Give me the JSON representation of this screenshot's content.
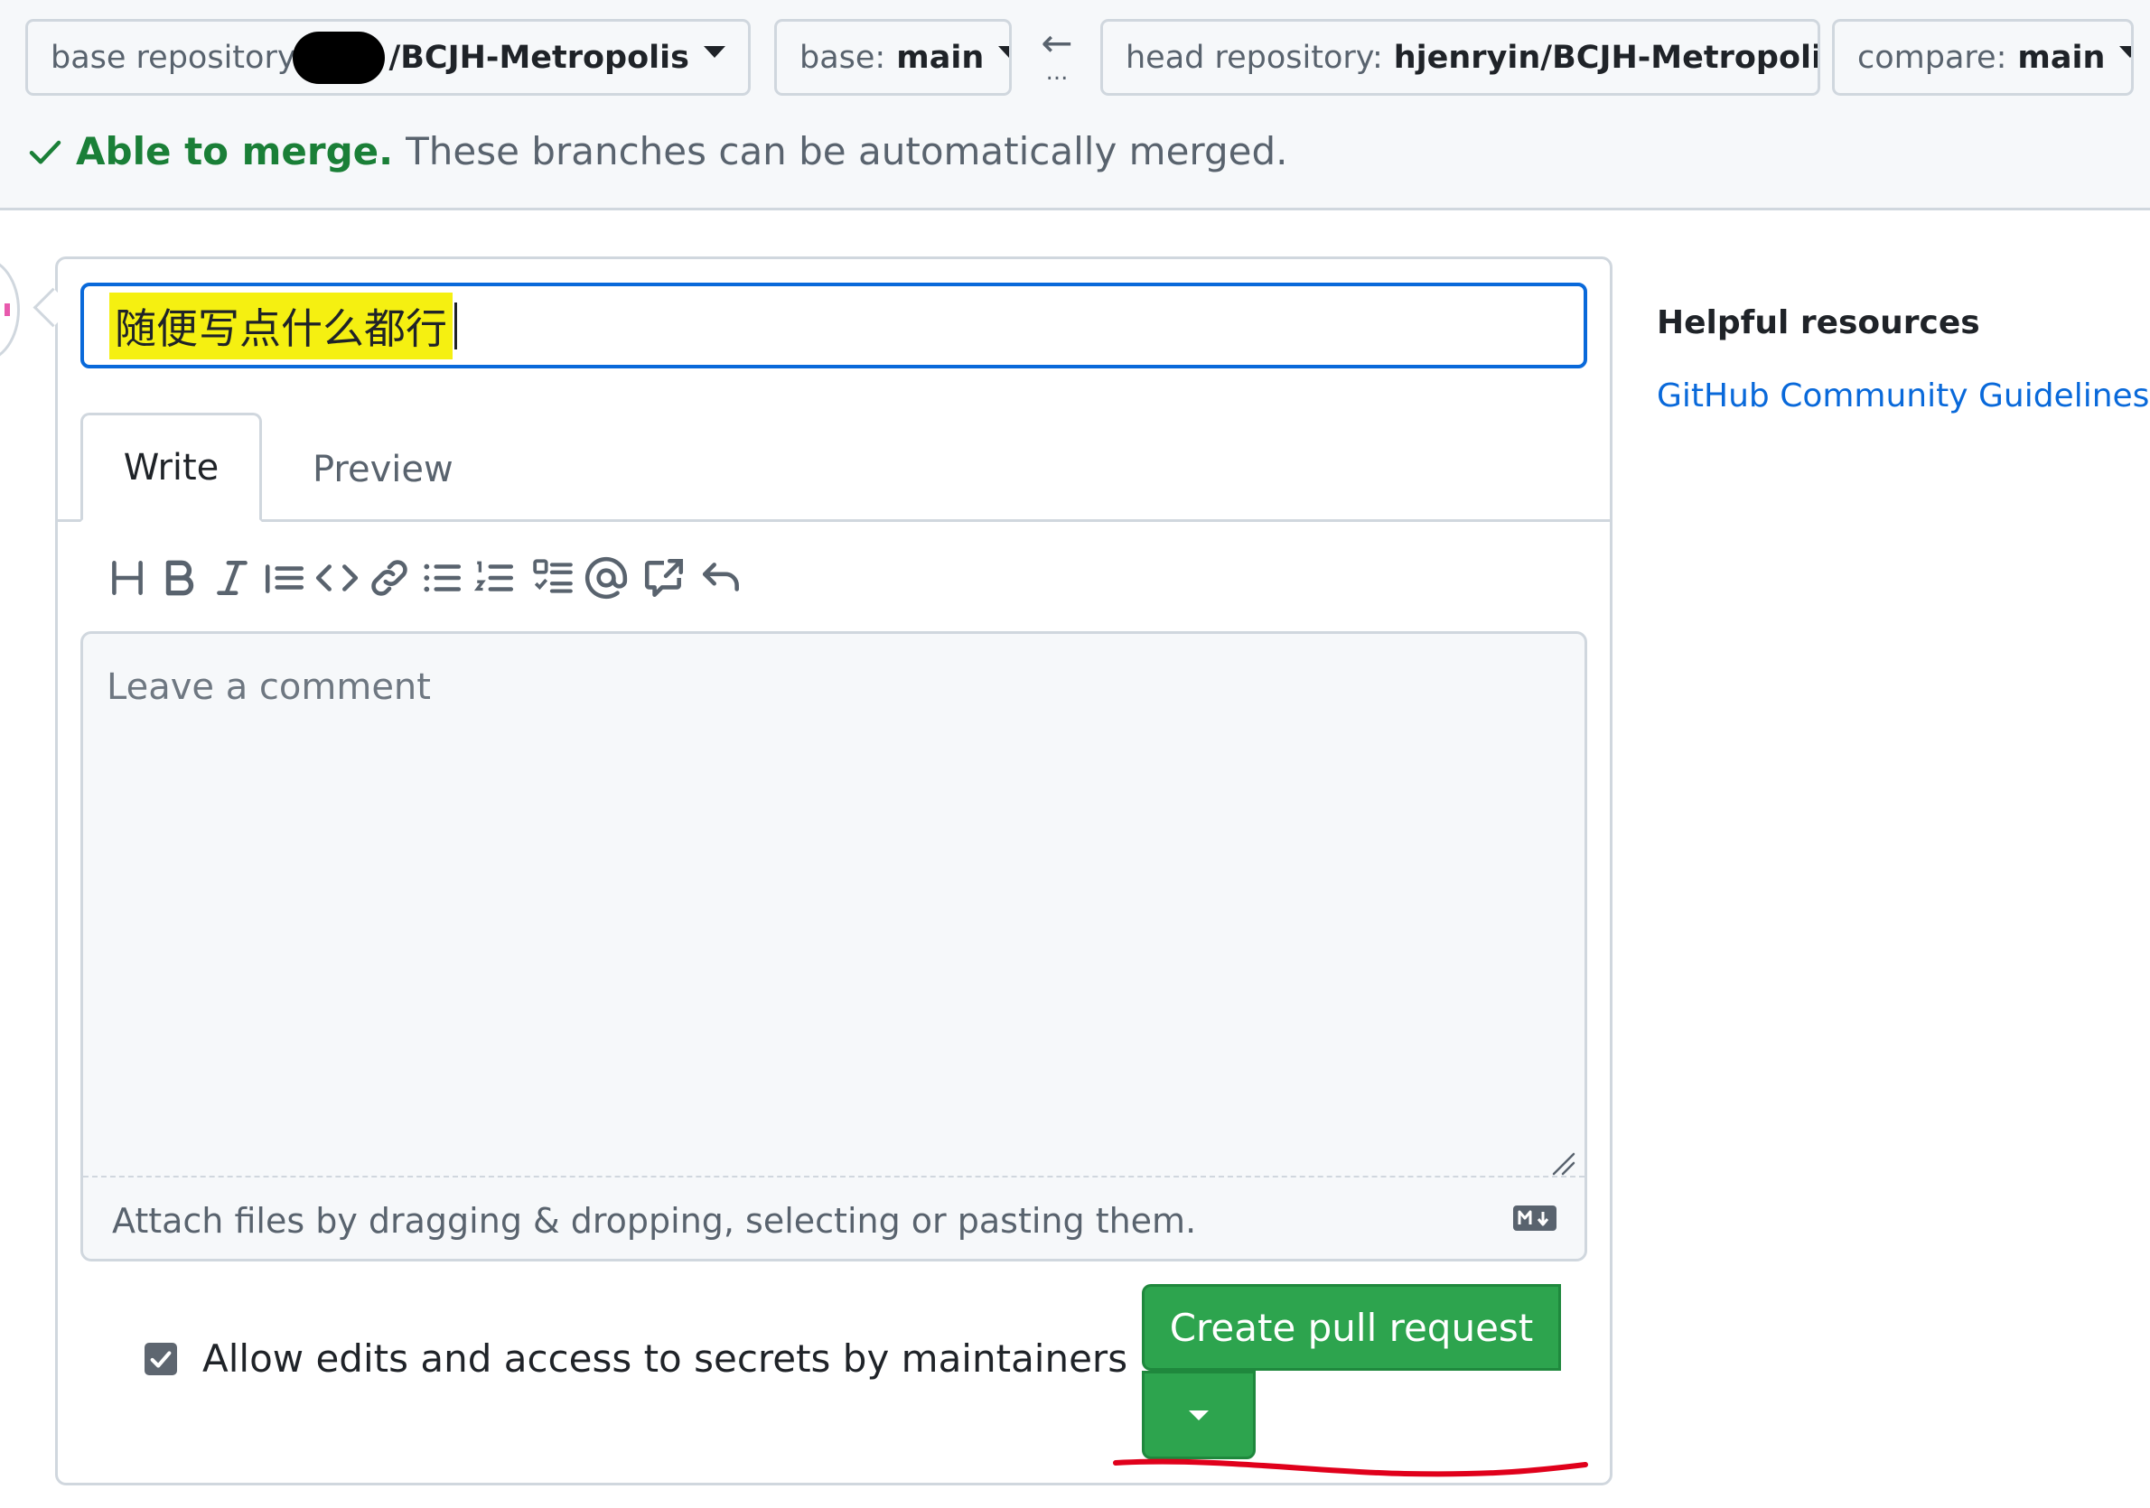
{
  "compare_bar": {
    "base_repo_label": "base repository",
    "base_repo_value": "/BCJH-Metropolis",
    "base_branch_label": "base:",
    "base_branch_value": "main",
    "arrow": "←",
    "dots": "...",
    "head_repo_label": "head repository:",
    "head_repo_value": "hjenryin/BCJH-Metropolis",
    "compare_label": "compare:",
    "compare_value": "main"
  },
  "merge_status": {
    "check": "✓",
    "ok_text": "Able to merge.",
    "description": "These branches can be automatically merged."
  },
  "form": {
    "title_value": "随便写点什么都行",
    "tabs": {
      "write": "Write",
      "preview": "Preview"
    },
    "toolbar_icons": [
      "heading-icon",
      "bold-icon",
      "italic-icon",
      "quote-icon",
      "code-icon",
      "link-icon",
      "bulleted-list-icon",
      "numbered-list-icon",
      "task-list-icon",
      "mention-icon",
      "reference-icon",
      "undo-icon"
    ],
    "comment_placeholder": "Leave a comment",
    "attach_text": "Attach files by dragging & dropping, selecting or pasting them.",
    "markdown_badge": "markdown-icon",
    "allow_edits_label": "Allow edits and access to secrets by maintainers",
    "allow_edits_checked": true,
    "help_icon": "?",
    "create_button": "Create pull request"
  },
  "sidebar": {
    "heading": "Helpful resources",
    "link": "GitHub Community Guidelines"
  },
  "colors": {
    "accent_blue": "#0969da",
    "success_green": "#1a7f37",
    "button_green": "#2da44e",
    "highlight_yellow": "#f5f011",
    "annotation_red": "#e0001b"
  }
}
